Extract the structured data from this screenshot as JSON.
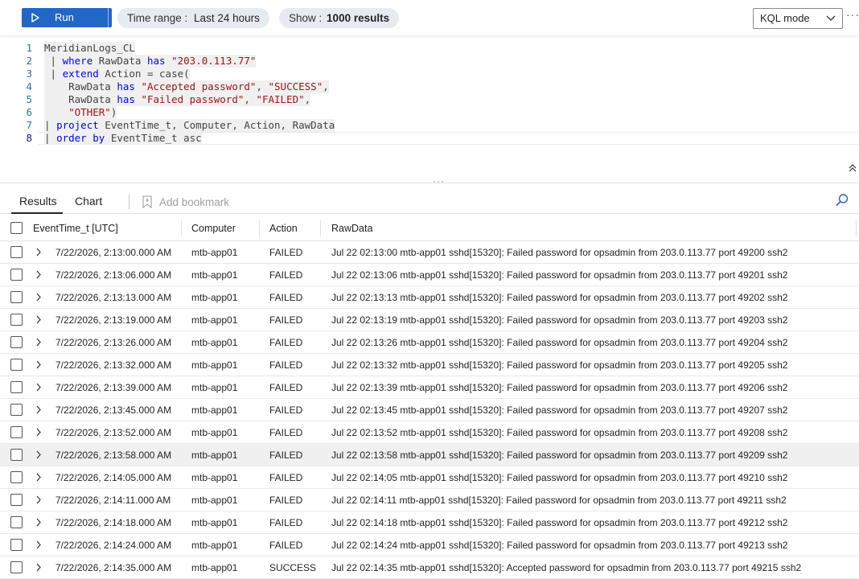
{
  "toolbar": {
    "run_label": "Run",
    "time_range_key": "Time range :",
    "time_range_value": "Last 24 hours",
    "show_key": "Show :",
    "show_value": "1000 results",
    "mode_label": "KQL mode",
    "more": "···"
  },
  "editor": {
    "line_numbers": [
      "1",
      "2",
      "3",
      "4",
      "5",
      "6",
      "7",
      "8"
    ]
  },
  "tabs": {
    "results": "Results",
    "chart": "Chart",
    "bookmark": "Add bookmark"
  },
  "table": {
    "columns": [
      "EventTime_t [UTC]",
      "Computer",
      "Action",
      "RawData"
    ],
    "rows": [
      {
        "time": "7/22/2026, 2:13:00.000 AM",
        "computer": "mtb-app01",
        "action": "FAILED",
        "raw": "Jul 22 02:13:00 mtb-app01 sshd[15320]: Failed password for opsadmin from 203.0.113.77 port 49200 ssh2"
      },
      {
        "time": "7/22/2026, 2:13:06.000 AM",
        "computer": "mtb-app01",
        "action": "FAILED",
        "raw": "Jul 22 02:13:06 mtb-app01 sshd[15320]: Failed password for opsadmin from 203.0.113.77 port 49201 ssh2"
      },
      {
        "time": "7/22/2026, 2:13:13.000 AM",
        "computer": "mtb-app01",
        "action": "FAILED",
        "raw": "Jul 22 02:13:13 mtb-app01 sshd[15320]: Failed password for opsadmin from 203.0.113.77 port 49202 ssh2"
      },
      {
        "time": "7/22/2026, 2:13:19.000 AM",
        "computer": "mtb-app01",
        "action": "FAILED",
        "raw": "Jul 22 02:13:19 mtb-app01 sshd[15320]: Failed password for opsadmin from 203.0.113.77 port 49203 ssh2"
      },
      {
        "time": "7/22/2026, 2:13:26.000 AM",
        "computer": "mtb-app01",
        "action": "FAILED",
        "raw": "Jul 22 02:13:26 mtb-app01 sshd[15320]: Failed password for opsadmin from 203.0.113.77 port 49204 ssh2"
      },
      {
        "time": "7/22/2026, 2:13:32.000 AM",
        "computer": "mtb-app01",
        "action": "FAILED",
        "raw": "Jul 22 02:13:32 mtb-app01 sshd[15320]: Failed password for opsadmin from 203.0.113.77 port 49205 ssh2"
      },
      {
        "time": "7/22/2026, 2:13:39.000 AM",
        "computer": "mtb-app01",
        "action": "FAILED",
        "raw": "Jul 22 02:13:39 mtb-app01 sshd[15320]: Failed password for opsadmin from 203.0.113.77 port 49206 ssh2"
      },
      {
        "time": "7/22/2026, 2:13:45.000 AM",
        "computer": "mtb-app01",
        "action": "FAILED",
        "raw": "Jul 22 02:13:45 mtb-app01 sshd[15320]: Failed password for opsadmin from 203.0.113.77 port 49207 ssh2"
      },
      {
        "time": "7/22/2026, 2:13:52.000 AM",
        "computer": "mtb-app01",
        "action": "FAILED",
        "raw": "Jul 22 02:13:52 mtb-app01 sshd[15320]: Failed password for opsadmin from 203.0.113.77 port 49208 ssh2"
      },
      {
        "time": "7/22/2026, 2:13:58.000 AM",
        "computer": "mtb-app01",
        "action": "FAILED",
        "raw": "Jul 22 02:13:58 mtb-app01 sshd[15320]: Failed password for opsadmin from 203.0.113.77 port 49209 ssh2"
      },
      {
        "time": "7/22/2026, 2:14:05.000 AM",
        "computer": "mtb-app01",
        "action": "FAILED",
        "raw": "Jul 22 02:14:05 mtb-app01 sshd[15320]: Failed password for opsadmin from 203.0.113.77 port 49210 ssh2"
      },
      {
        "time": "7/22/2026, 2:14:11.000 AM",
        "computer": "mtb-app01",
        "action": "FAILED",
        "raw": "Jul 22 02:14:11 mtb-app01 sshd[15320]: Failed password for opsadmin from 203.0.113.77 port 49211 ssh2"
      },
      {
        "time": "7/22/2026, 2:14:18.000 AM",
        "computer": "mtb-app01",
        "action": "FAILED",
        "raw": "Jul 22 02:14:18 mtb-app01 sshd[15320]: Failed password for opsadmin from 203.0.113.77 port 49212 ssh2"
      },
      {
        "time": "7/22/2026, 2:14:24.000 AM",
        "computer": "mtb-app01",
        "action": "FAILED",
        "raw": "Jul 22 02:14:24 mtb-app01 sshd[15320]: Failed password for opsadmin from 203.0.113.77 port 49213 ssh2"
      },
      {
        "time": "7/22/2026, 2:14:35.000 AM",
        "computer": "mtb-app01",
        "action": "SUCCESS",
        "raw": "Jul 22 02:14:35 mtb-app01 sshd[15320]: Accepted password for opsadmin from 203.0.113.77 port 49215 ssh2"
      }
    ]
  },
  "query": {
    "table_name": "MeridianLogs_CL",
    "pipe": "|",
    "kw_where": "where",
    "raw_field": "RawData",
    "kw_has": "has",
    "ip_literal": "\"203.0.113.77\"",
    "kw_extend": "extend",
    "action_eq_case": "Action = case(",
    "lit_accepted": "\"Accepted password\"",
    "lit_success": "\"SUCCESS\"",
    "lit_failed_pw": "\"Failed password\"",
    "lit_failed": "\"FAILED\"",
    "lit_other": "\"OTHER\"",
    "close_paren": ")",
    "kw_project": "project",
    "project_cols": "EventTime_t, Computer, Action, RawData",
    "kw_order": "order",
    "kw_by": "by",
    "order_tail": "EventTime_t asc",
    "comma": ","
  }
}
